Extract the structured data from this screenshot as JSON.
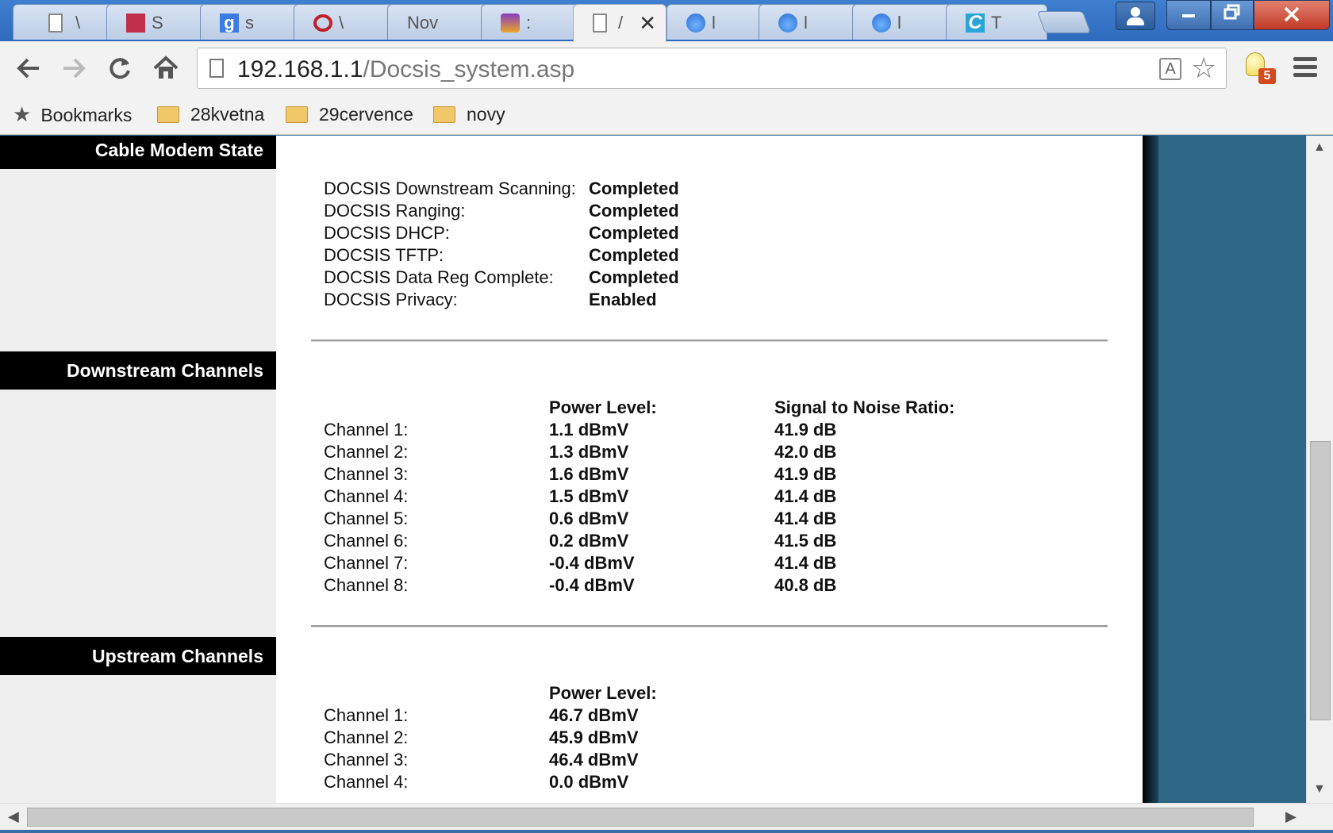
{
  "browser": {
    "tabs": [
      {
        "title": "\\",
        "favicon": "doc-icon"
      },
      {
        "title": "S",
        "favicon": "red-app-icon"
      },
      {
        "title": "s",
        "favicon": "google-icon"
      },
      {
        "title": "\\",
        "favicon": "opera-icon"
      },
      {
        "title": "Nov",
        "favicon": "none"
      },
      {
        "title": ":",
        "favicon": "flame-icon"
      },
      {
        "title": "/",
        "favicon": "doc-icon",
        "active": true
      },
      {
        "title": "l",
        "favicon": "drop-icon"
      },
      {
        "title": "l",
        "favicon": "drop-icon"
      },
      {
        "title": "l",
        "favicon": "drop-icon"
      },
      {
        "title": "T",
        "favicon": "ci-icon"
      }
    ],
    "tab_close_glyph": "✕",
    "url_host": "192.168.1.1",
    "url_path": "/Docsis_system.asp",
    "extension_badge": "5",
    "bookmarks": {
      "label": "Bookmarks",
      "folders": [
        "28kvetna",
        "29cervence",
        "novy"
      ]
    }
  },
  "page": {
    "sections": {
      "cable_modem_state": "Cable Modem State",
      "downstream": "Downstream Channels",
      "upstream": "Upstream Channels"
    },
    "modem_state": [
      {
        "label": "DOCSIS Downstream Scanning:",
        "value": "Completed"
      },
      {
        "label": "DOCSIS Ranging:",
        "value": "Completed"
      },
      {
        "label": "DOCSIS DHCP:",
        "value": "Completed"
      },
      {
        "label": "DOCSIS TFTP:",
        "value": "Completed"
      },
      {
        "label": "DOCSIS Data Reg Complete:",
        "value": "Completed"
      },
      {
        "label": "DOCSIS Privacy:",
        "value": "Enabled"
      }
    ],
    "downstream": {
      "power_header": "Power Level:",
      "snr_header": "Signal to Noise Ratio:",
      "rows": [
        {
          "channel": "Channel 1:",
          "power": "1.1 dBmV",
          "snr": "41.9 dB"
        },
        {
          "channel": "Channel 2:",
          "power": "1.3 dBmV",
          "snr": "42.0 dB"
        },
        {
          "channel": "Channel 3:",
          "power": "1.6 dBmV",
          "snr": "41.9 dB"
        },
        {
          "channel": "Channel 4:",
          "power": "1.5 dBmV",
          "snr": "41.4 dB"
        },
        {
          "channel": "Channel 5:",
          "power": "0.6 dBmV",
          "snr": "41.4 dB"
        },
        {
          "channel": "Channel 6:",
          "power": "0.2 dBmV",
          "snr": "41.5 dB"
        },
        {
          "channel": "Channel 7:",
          "power": "-0.4 dBmV",
          "snr": "41.4 dB"
        },
        {
          "channel": "Channel 8:",
          "power": "-0.4 dBmV",
          "snr": "40.8 dB"
        }
      ]
    },
    "upstream": {
      "power_header": "Power Level:",
      "rows": [
        {
          "channel": "Channel 1:",
          "power": "46.7 dBmV"
        },
        {
          "channel": "Channel 2:",
          "power": "45.9 dBmV"
        },
        {
          "channel": "Channel 3:",
          "power": "46.4 dBmV"
        },
        {
          "channel": "Channel 4:",
          "power": "0.0 dBmV"
        }
      ]
    }
  },
  "colors": {
    "header_bg": "#000000",
    "sidebar_bg": "#efefef",
    "right_panel": "#2e6785"
  }
}
